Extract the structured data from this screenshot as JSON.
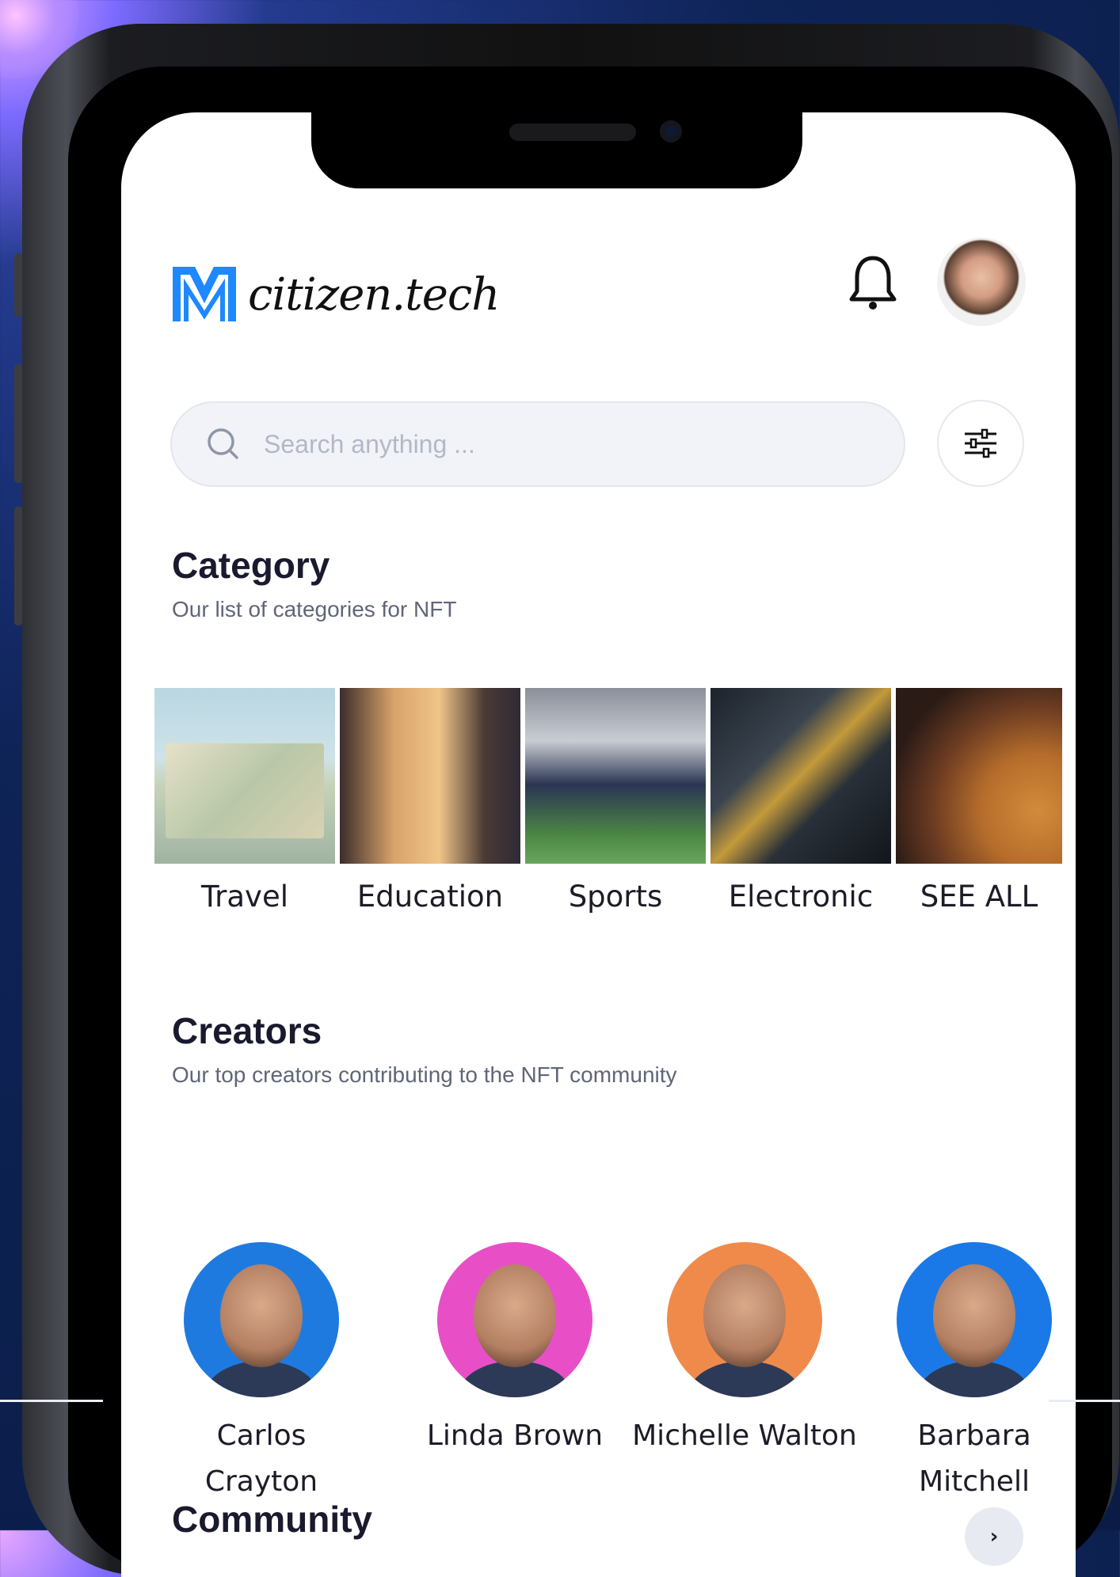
{
  "header": {
    "logo_text": "citizen.tech",
    "brand_color": "#1e88ff"
  },
  "search": {
    "placeholder": "Search anything ...",
    "value": ""
  },
  "category": {
    "title": "Category",
    "subtitle": "Our list of categories for NFT",
    "items": [
      {
        "label": "Travel"
      },
      {
        "label": "Education"
      },
      {
        "label": "Sports"
      },
      {
        "label": "Electronic"
      },
      {
        "label": "SEE ALL"
      }
    ]
  },
  "creators": {
    "title": "Creators",
    "subtitle": "Our top creators contributing to the NFT community",
    "items": [
      {
        "name": "Carlos Crayton",
        "bg_color": "#1f7ae0"
      },
      {
        "name": "Linda Brown",
        "bg_color": "#e84fc6"
      },
      {
        "name": "Michelle Walton",
        "bg_color": "#f08a4b"
      },
      {
        "name": "Barbara Mitchell",
        "bg_color": "#1a79e6"
      }
    ]
  },
  "community": {
    "title": "Community",
    "next_icon": "›"
  },
  "icons": {
    "bell": "bell-icon",
    "search": "search-icon",
    "filter": "sliders-icon",
    "next": "chevron-right-icon"
  }
}
